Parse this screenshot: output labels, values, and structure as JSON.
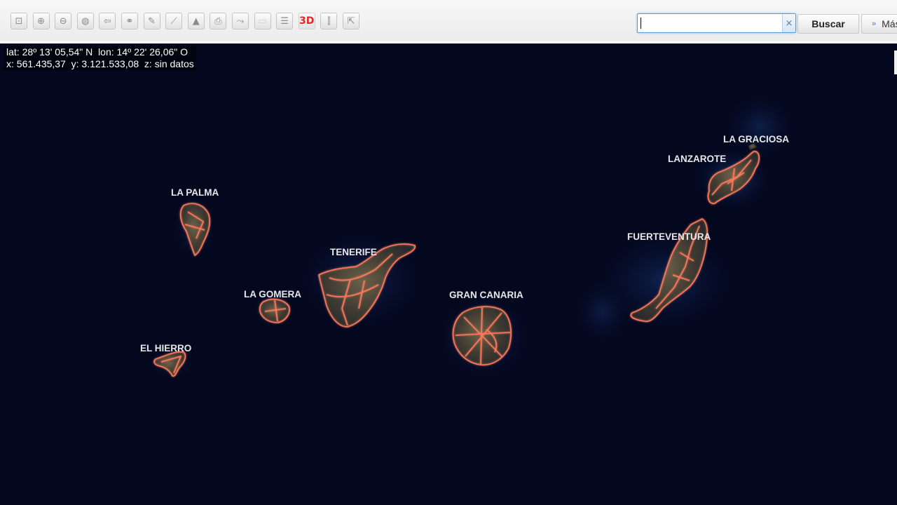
{
  "toolbar": {
    "tools": [
      {
        "name": "zoom-extent-icon",
        "glyph": "⊡",
        "enabled": true
      },
      {
        "name": "zoom-in-icon",
        "glyph": "⊕",
        "enabled": true
      },
      {
        "name": "zoom-out-icon",
        "glyph": "⊖",
        "enabled": true
      },
      {
        "name": "globe-icon",
        "glyph": "◍",
        "enabled": true
      },
      {
        "name": "back-arrow-icon",
        "glyph": "⇦",
        "enabled": true
      },
      {
        "name": "link-icon",
        "glyph": "⚭",
        "enabled": true
      },
      {
        "name": "pencil-icon",
        "glyph": "✎",
        "enabled": true
      },
      {
        "name": "ruler-icon",
        "glyph": "⟋",
        "enabled": true
      },
      {
        "name": "terrain-icon",
        "glyph": "▲",
        "enabled": true
      },
      {
        "name": "print-icon",
        "glyph": "⎙",
        "enabled": true
      },
      {
        "name": "route-icon",
        "glyph": "⤳",
        "enabled": true
      },
      {
        "name": "legend-icon",
        "glyph": "▭",
        "enabled": false
      },
      {
        "name": "layers-icon",
        "glyph": "☰",
        "enabled": true
      },
      {
        "name": "3d-view-icon",
        "glyph": "3D",
        "enabled": true,
        "accent": "#e3262b"
      },
      {
        "name": "compare-icon",
        "glyph": "⫿",
        "enabled": true
      },
      {
        "name": "share-icon",
        "glyph": "⇱",
        "enabled": true
      }
    ]
  },
  "search": {
    "value": "",
    "clear_label": "×",
    "button_label": "Buscar",
    "more_label": "Más",
    "more_icon": "»"
  },
  "coords": {
    "line1": "lat: 28º 13' 05,54\" N  lon: 14º 22' 26,06\" O",
    "line2": "x: 561.435,37  y: 3.121.533,08  z: sin datos"
  },
  "map": {
    "ocean_color": "#04081f",
    "road_color": "#ff7a5c",
    "islands": [
      {
        "id": "la-graciosa",
        "label": "LA GRACIOSA"
      },
      {
        "id": "lanzarote",
        "label": "LANZAROTE"
      },
      {
        "id": "la-palma",
        "label": "LA PALMA"
      },
      {
        "id": "fuerteventura",
        "label": "FUERTEVENTURA"
      },
      {
        "id": "tenerife",
        "label": "TENERIFE"
      },
      {
        "id": "la-gomera",
        "label": "LA GOMERA"
      },
      {
        "id": "gran-canaria",
        "label": "GRAN CANARIA"
      },
      {
        "id": "el-hierro",
        "label": "EL HIERRO"
      }
    ]
  }
}
